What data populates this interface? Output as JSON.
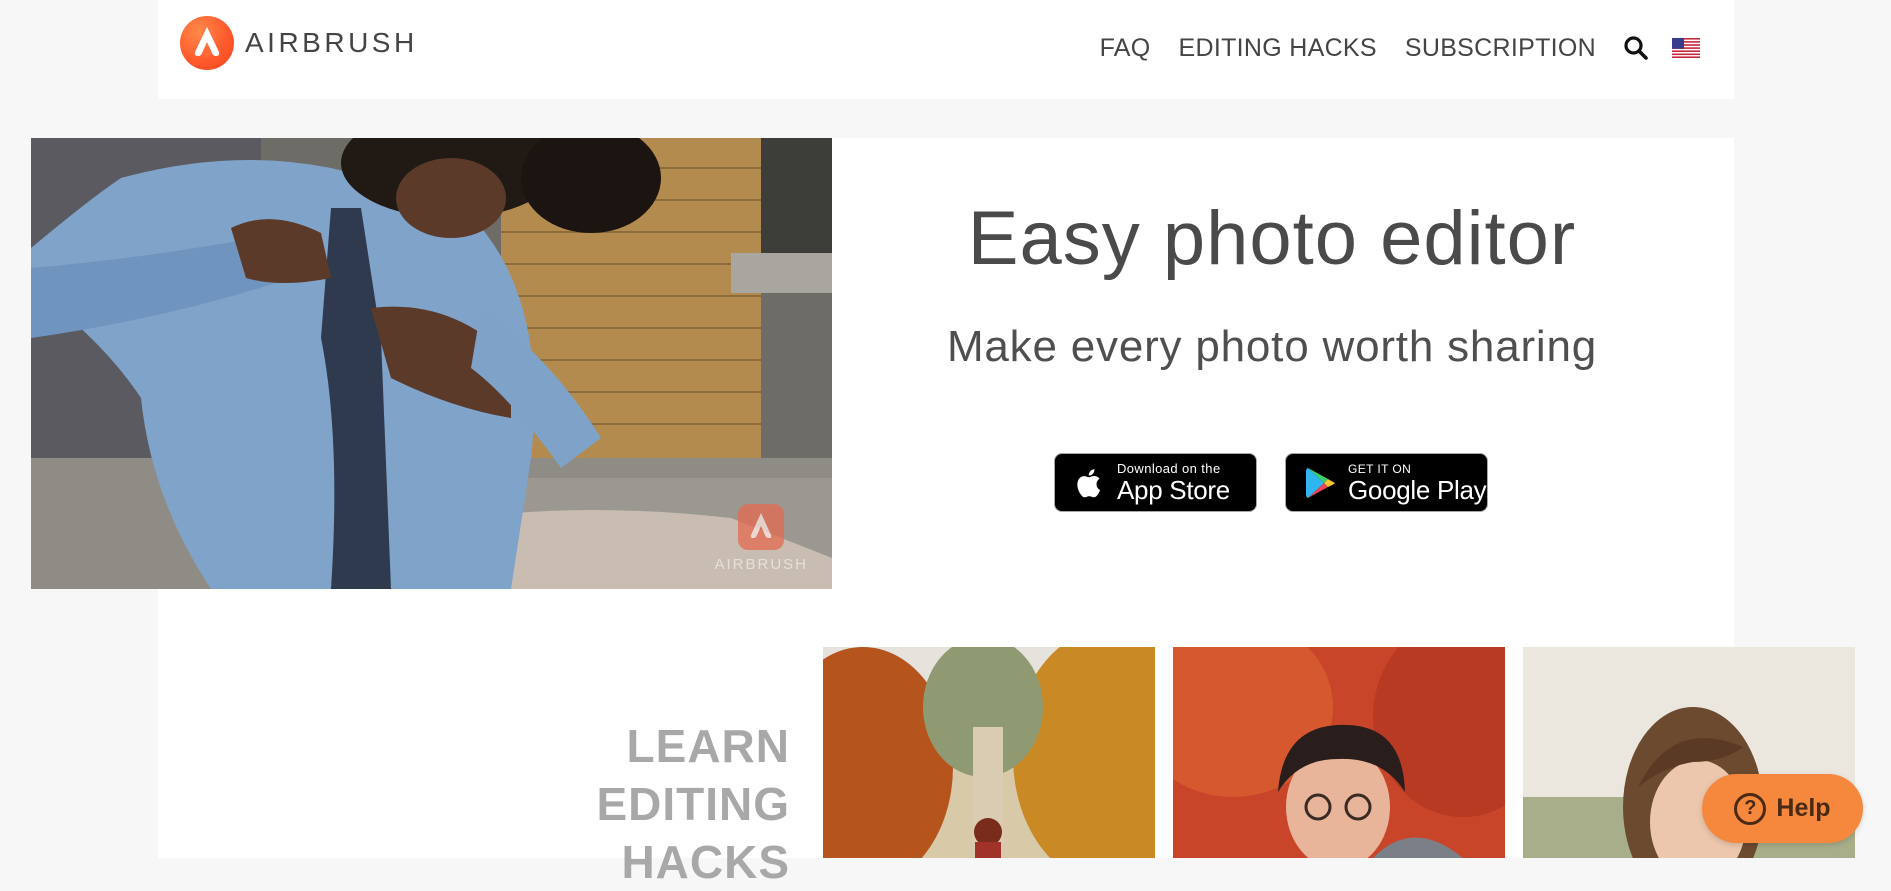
{
  "header": {
    "logo_text": "AIRBRUSH",
    "nav": [
      {
        "label": "FAQ"
      },
      {
        "label": "EDITING HACKS"
      },
      {
        "label": "SUBSCRIPTION"
      }
    ],
    "search_icon": "search-icon",
    "language_icon": "us-flag-icon"
  },
  "hero": {
    "title": "Easy photo editor",
    "subtitle": "Make every photo worth sharing",
    "video_watermark": "AIRBRUSH",
    "app_store": {
      "small": "Download on the",
      "big": "App Store"
    },
    "google_play": {
      "small": "GET IT ON",
      "big": "Google Play"
    }
  },
  "hacks": {
    "title_lines": [
      "LEARN",
      "EDITING",
      "HACKS"
    ]
  },
  "help": {
    "label": "Help",
    "icon": "?"
  },
  "colors": {
    "brand_orange": "#ff5a2c",
    "help_orange": "#f6883e",
    "text": "#4a4a4a",
    "muted": "#a8a8a8"
  }
}
